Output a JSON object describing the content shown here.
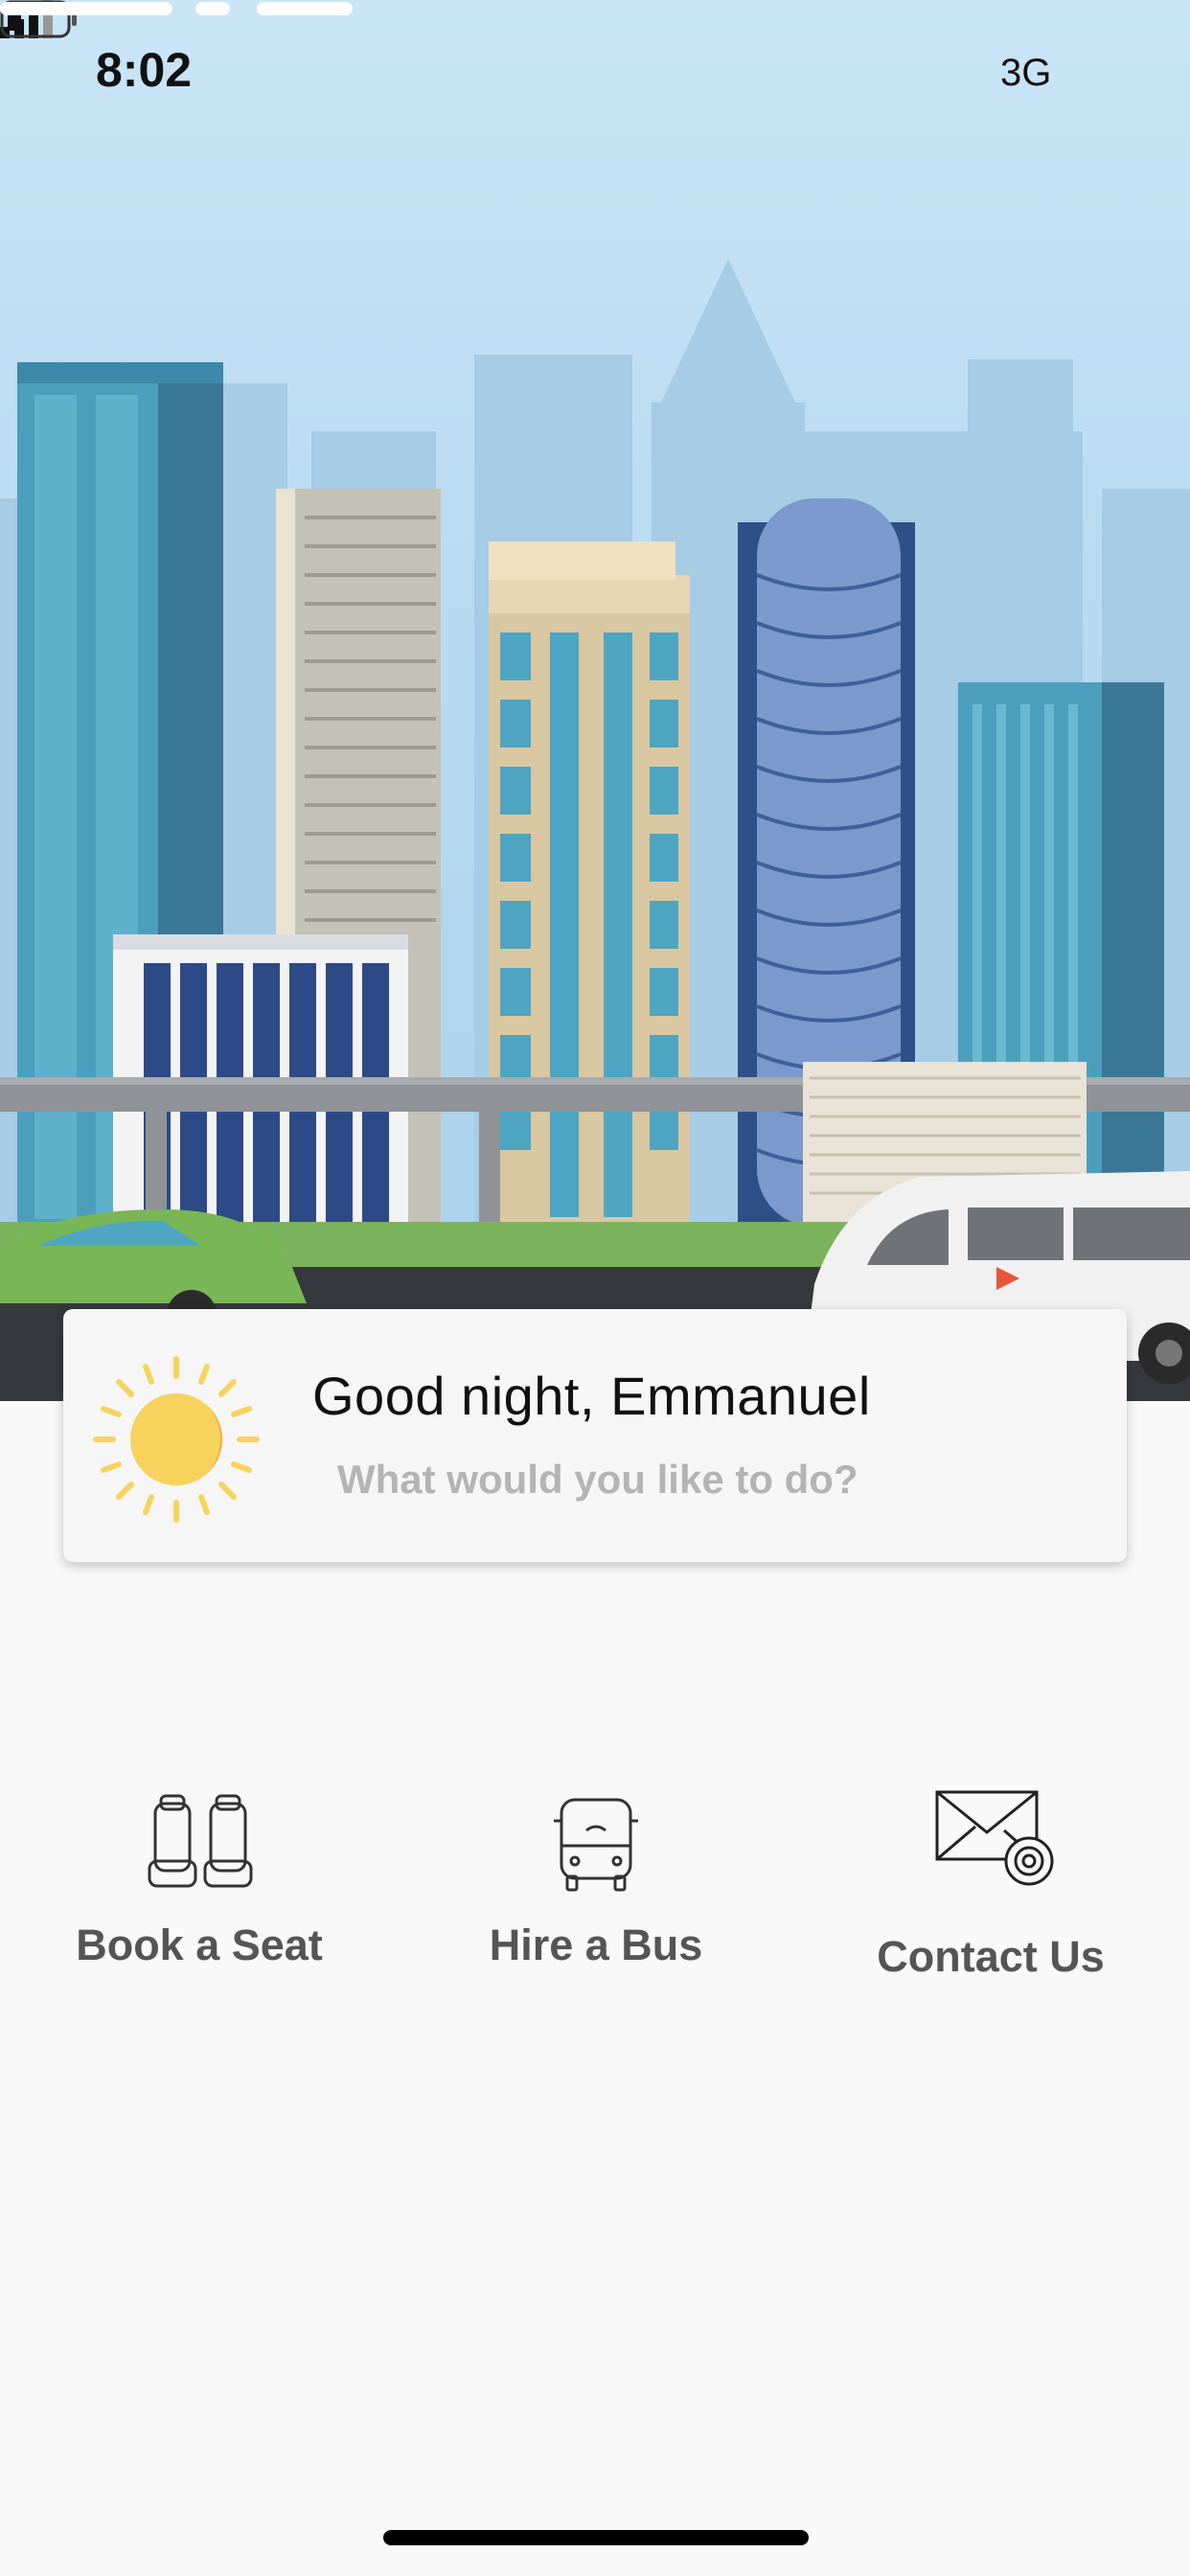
{
  "status_bar": {
    "time": "8:02",
    "network": "3G"
  },
  "greeting": {
    "title": "Good night, Emmanuel",
    "subtitle": "What would you like to do?",
    "icon": "sun-icon"
  },
  "actions": [
    {
      "label": "Book a Seat",
      "icon": "seat-icon"
    },
    {
      "label": "Hire a Bus",
      "icon": "bus-icon"
    },
    {
      "label": "Contact Us",
      "icon": "mail-icon"
    }
  ],
  "colors": {
    "sky": "#c9e5f7",
    "card_background": "#f6f6f6",
    "title_text": "#111111",
    "subtitle_text": "#b4b4b4",
    "action_label": "#555555",
    "sun": "#f7d35e"
  }
}
